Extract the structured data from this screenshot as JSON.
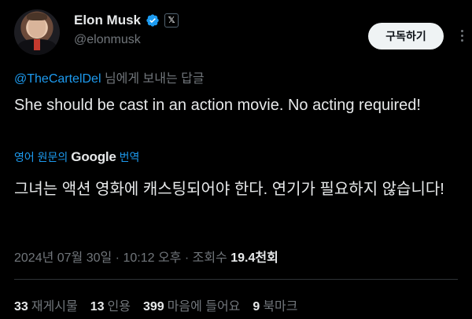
{
  "author": {
    "name": "Elon Musk",
    "handle": "@elonmusk",
    "badge_letter": "𝕏"
  },
  "header": {
    "subscribe_label": "구독하기"
  },
  "reply": {
    "mention": "@TheCartelDel",
    "suffix": " 님에게 보내는 답글"
  },
  "tweet": {
    "text": "She should be cast in an action movie. No  acting required!",
    "translate_prefix": "영어 원문의",
    "translate_brand": "Google",
    "translate_suffix": "번역",
    "translated_text": "그녀는 액션 영화에 캐스팅되어야 한다. 연기가 필요하지 않습니다!"
  },
  "meta": {
    "datetime": "2024년 07월 30일 · 10:12 오후 · 조회수 ",
    "views": "19.4천회"
  },
  "stats": {
    "reposts_count": "33",
    "reposts_label": "재게시물",
    "quotes_count": "13",
    "quotes_label": "인용",
    "likes_count": "399",
    "likes_label": "마음에 들어요",
    "bookmarks_count": "9",
    "bookmarks_label": "북마크"
  },
  "colors": {
    "background": "#000000",
    "accent": "#1d9bf0",
    "muted": "#71767b",
    "text": "#e7e9ea"
  }
}
